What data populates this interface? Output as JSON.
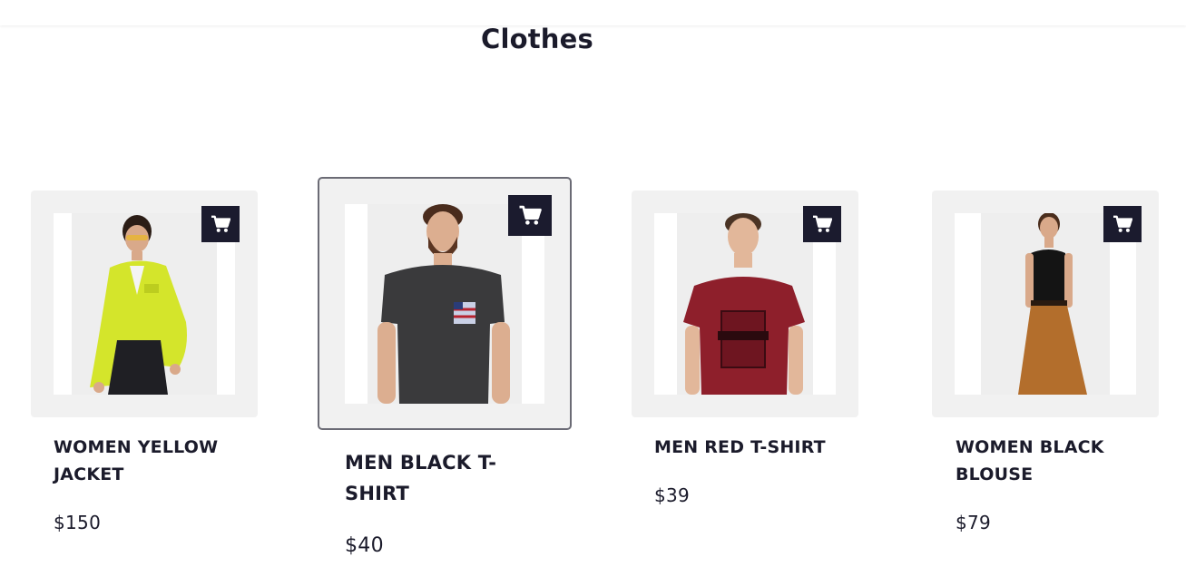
{
  "page": {
    "title": "Clothes"
  },
  "products": [
    {
      "name": "WOMEN YELLOW JACKET",
      "price": "$150",
      "cart_icon": "cart-icon"
    },
    {
      "name": "MEN BLACK T-SHIRT",
      "price": "$40",
      "cart_icon": "cart-icon"
    },
    {
      "name": "MEN RED T-SHIRT",
      "price": "$39",
      "cart_icon": "cart-icon"
    },
    {
      "name": "WOMEN BLACK BLOUSE",
      "price": "$79",
      "cart_icon": "cart-icon"
    }
  ],
  "colors": {
    "frame_bg": "#f1f1f1",
    "cart_button": "#1b1b2e",
    "text": "#1b1b2b",
    "jacket": "#d4e52b",
    "black_tee": "#3a3a3c",
    "red_tee": "#8e1f2b",
    "blouse_pants": "#b36e2c"
  }
}
